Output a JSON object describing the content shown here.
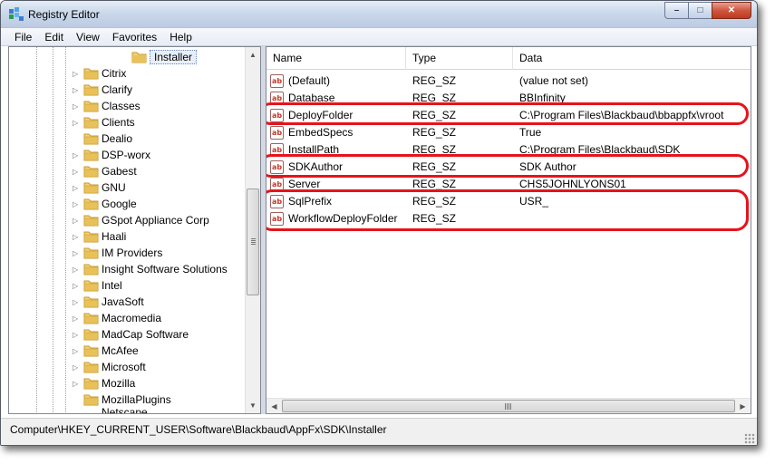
{
  "window": {
    "title": "Registry Editor",
    "caption": {
      "minimize": "–",
      "maximize": "□",
      "close": "✕"
    }
  },
  "menu": [
    "File",
    "Edit",
    "View",
    "Favorites",
    "Help"
  ],
  "tree": {
    "selected": "Installer",
    "items": [
      "Citrix",
      "Clarify",
      "Classes",
      "Clients",
      "Dealio",
      "DSP-worx",
      "Gabest",
      "GNU",
      "Google",
      "GSpot Appliance Corp",
      "Haali",
      "IM Providers",
      "Insight Software Solutions",
      "Intel",
      "JavaSoft",
      "Macromedia",
      "MadCap Software",
      "McAfee",
      "Microsoft",
      "Mozilla",
      "MozillaPlugins"
    ],
    "expand_arrow": "▷",
    "partial_item": "Netscape"
  },
  "list": {
    "columns": [
      "Name",
      "Type",
      "Data"
    ],
    "rows": [
      {
        "name": "(Default)",
        "type": "REG_SZ",
        "data": "(value not set)"
      },
      {
        "name": "Database",
        "type": "REG_SZ",
        "data": "BBInfinity"
      },
      {
        "name": "DeployFolder",
        "type": "REG_SZ",
        "data": "C:\\Program Files\\Blackbaud\\bbappfx\\vroot"
      },
      {
        "name": "EmbedSpecs",
        "type": "REG_SZ",
        "data": "True"
      },
      {
        "name": "InstallPath",
        "type": "REG_SZ",
        "data": "C:\\Program Files\\Blackbaud\\SDK"
      },
      {
        "name": "SDKAuthor",
        "type": "REG_SZ",
        "data": "SDK Author"
      },
      {
        "name": "Server",
        "type": "REG_SZ",
        "data": "CHS5JOHNLYONS01"
      },
      {
        "name": "SqlPrefix",
        "type": "REG_SZ",
        "data": "USR_"
      },
      {
        "name": "WorkflowDeployFolder",
        "type": "REG_SZ",
        "data": ""
      }
    ],
    "value_icon_text": "ab",
    "highlighted_rows": [
      "DeployFolder",
      "SDKAuthor",
      "SqlPrefix",
      "WorkflowDeployFolder"
    ]
  },
  "status": {
    "path": "Computer\\HKEY_CURRENT_USER\\Software\\Blackbaud\\AppFx\\SDK\\Installer"
  },
  "colors": {
    "highlight": "#e5141b",
    "folder": "#e8c15a"
  }
}
